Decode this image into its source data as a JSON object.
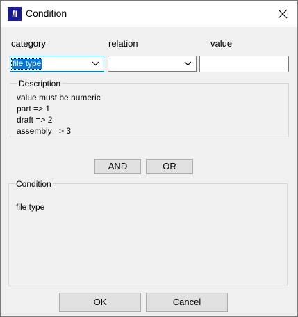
{
  "window": {
    "title": "Condition",
    "icon_text": "/II",
    "icon": "app-logo-icon",
    "close_icon": "close-icon"
  },
  "fields": {
    "category_label": "category",
    "relation_label": "relation",
    "value_label": "value",
    "category_selected": "file type",
    "relation_selected": "",
    "value_text": ""
  },
  "description": {
    "title": "Description",
    "lines": [
      "value must be numeric",
      "part => 1",
      "draft => 2",
      "assembly => 3"
    ]
  },
  "logic_buttons": {
    "and_label": "AND",
    "or_label": "OR"
  },
  "condition_group": {
    "title": "Condition",
    "text": "file type"
  },
  "footer": {
    "ok_label": "OK",
    "cancel_label": "Cancel"
  },
  "colors": {
    "selection": "#0078d7",
    "app_icon_bg": "#1a1a8c"
  }
}
